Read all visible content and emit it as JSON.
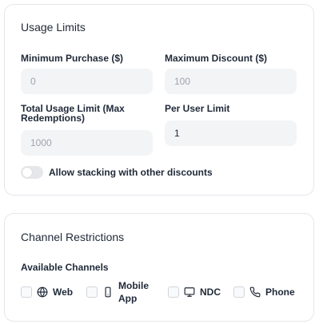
{
  "usage_limits": {
    "title": "Usage Limits",
    "minimum_purchase": {
      "label": "Minimum Purchase ($)",
      "placeholder": "0",
      "value": ""
    },
    "maximum_discount": {
      "label": "Maximum Discount ($)",
      "placeholder": "100",
      "value": ""
    },
    "total_usage_limit": {
      "label": "Total Usage Limit (Max Redemptions)",
      "placeholder": "1000",
      "value": ""
    },
    "per_user_limit": {
      "label": "Per User Limit",
      "placeholder": "",
      "value": "1"
    },
    "stacking_toggle": {
      "label": "Allow stacking with other discounts",
      "enabled": false
    }
  },
  "channel_restrictions": {
    "title": "Channel Restrictions",
    "available_label": "Available Channels",
    "channels": [
      {
        "label": "Web",
        "icon": "globe-icon",
        "checked": false
      },
      {
        "label": "Mobile App",
        "icon": "smartphone-icon",
        "checked": false
      },
      {
        "label": "NDC",
        "icon": "monitor-icon",
        "checked": false
      },
      {
        "label": "Phone",
        "icon": "phone-icon",
        "checked": false
      }
    ]
  },
  "colors": {
    "card_border": "#e5e7eb",
    "input_bg": "#f3f4f6",
    "text": "#1f2937",
    "placeholder": "#9ca3af",
    "toggle_off": "#e5e7eb"
  }
}
